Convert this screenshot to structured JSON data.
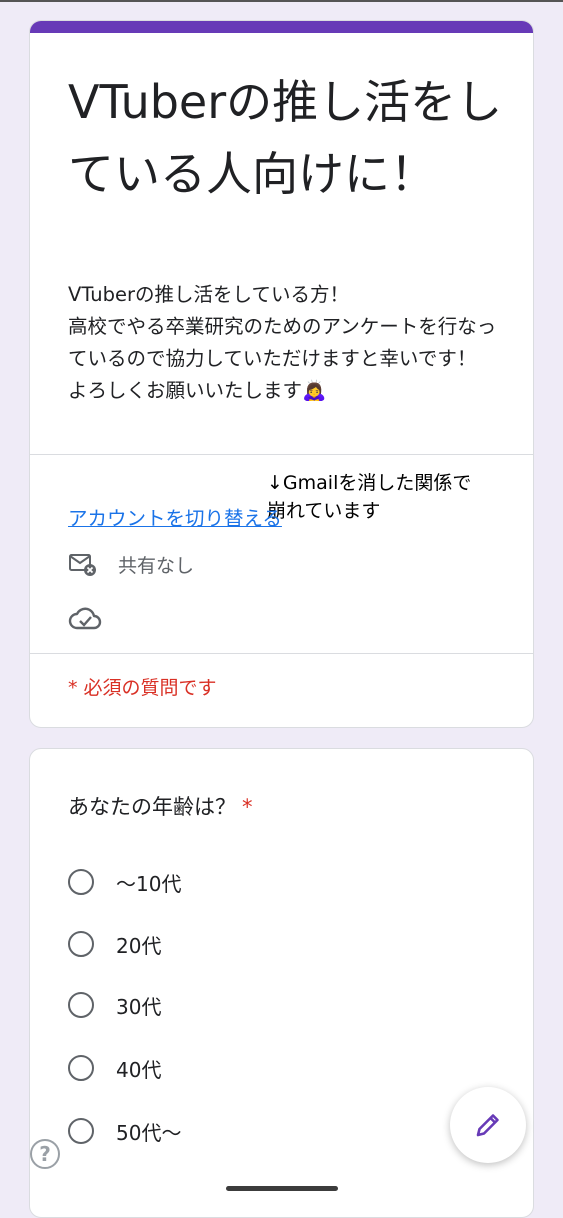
{
  "form": {
    "title": "VTuberの推し活をしている人向けに！",
    "description": "VTuberの推し活をしている方！\n高校でやる卒業研究のためのアンケートを行なっているので協力していただけますと幸いです！\nよろしくお願いいたします🙇‍♀️",
    "annotation": "↓Gmailを消した関係で\n崩れています",
    "switch_account": "アカウントを切り替える",
    "shared_status": "共有なし",
    "required_note": "* 必須の質問です",
    "accent_color": "#673ab7"
  },
  "question1": {
    "title": "あなたの年齢は？",
    "required_mark": "*",
    "options": [
      "〜10代",
      "20代",
      "30代",
      "40代",
      "50代〜"
    ]
  },
  "icons": {
    "shared": "mail-off-icon",
    "saved": "cloud-check-icon",
    "edit": "pencil-icon",
    "help": "help-icon"
  },
  "help_glyph": "?"
}
